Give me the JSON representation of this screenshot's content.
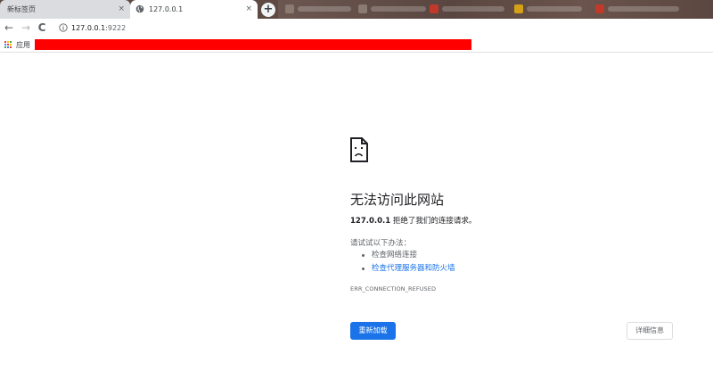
{
  "tabs": [
    {
      "title": "新标签页",
      "active": false
    },
    {
      "title": "127.0.0.1",
      "active": true
    }
  ],
  "tab_close_glyph": "×",
  "new_tab_glyph": "+",
  "toolbar": {
    "back_glyph": "←",
    "forward_glyph": "→",
    "reload_glyph": "C",
    "url_host": "127.0.0.1",
    "url_port": ":9222"
  },
  "bookmarks": {
    "apps_label": "应用"
  },
  "error": {
    "title": "无法访问此网站",
    "host": "127.0.0.1",
    "summary_rest": " 拒绝了我们的连接请求。",
    "try_label": "请试试以下办法：",
    "suggestions": [
      {
        "text": "检查网络连接",
        "link": false
      },
      {
        "text": "检查代理服务器和防火墙",
        "link": true
      }
    ],
    "code": "ERR_CONNECTION_REFUSED"
  },
  "buttons": {
    "reload": "重新加载",
    "details": "详细信息"
  },
  "colors": {
    "accent_blue": "#1a73e8",
    "redaction_red": "#ff0000",
    "tabstrip_bg": "#5e4a43"
  }
}
